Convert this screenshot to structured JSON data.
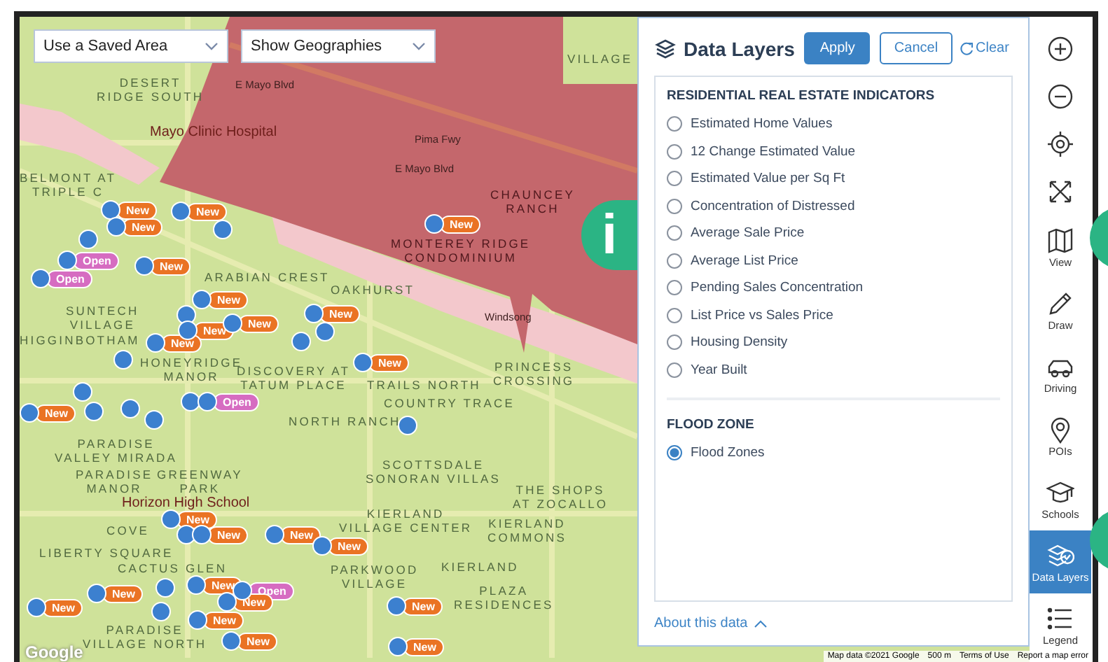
{
  "map": {
    "dropdowns": [
      {
        "value": "Use a Saved Area"
      },
      {
        "value": "Show Geographies"
      }
    ],
    "labels": [
      {
        "kind": "area",
        "lines": [
          "DESERT",
          "RIDGE SOUTH"
        ]
      },
      {
        "kind": "poi",
        "lines": [
          "Mayo Clinic Hospital"
        ]
      },
      {
        "kind": "area",
        "lines": [
          "BELMONT AT",
          "TRIPLE C"
        ]
      },
      {
        "kind": "zone",
        "lines": [
          "CHAUNCEY",
          "RANCH"
        ]
      },
      {
        "kind": "zone",
        "lines": [
          "MONTEREY RIDGE",
          "CONDOMINIUM"
        ]
      },
      {
        "kind": "area",
        "lines": [
          "ARABIAN CREST"
        ]
      },
      {
        "kind": "area",
        "lines": [
          "OAKHURST"
        ]
      },
      {
        "kind": "area",
        "lines": [
          "SUNTECH",
          "VILLAGE"
        ]
      },
      {
        "kind": "area",
        "lines": [
          "HIGGINBOTHAM"
        ]
      },
      {
        "kind": "area",
        "lines": [
          "HONEYRIDGE",
          "MANOR"
        ]
      },
      {
        "kind": "area",
        "lines": [
          "DISCOVERY AT",
          "TATUM PLACE"
        ]
      },
      {
        "kind": "area",
        "lines": [
          "TRAILS NORTH"
        ]
      },
      {
        "kind": "area",
        "lines": [
          "PRINCESS",
          "CROSSING"
        ]
      },
      {
        "kind": "area",
        "lines": [
          "COUNTRY TRACE"
        ]
      },
      {
        "kind": "area",
        "lines": [
          "NORTH RANCH"
        ]
      },
      {
        "kind": "area",
        "lines": [
          "PARADISE",
          "VALLEY MIRADA"
        ]
      },
      {
        "kind": "area",
        "lines": [
          "PARADISE",
          "MANOR"
        ]
      },
      {
        "kind": "area",
        "lines": [
          "GREENWAY",
          "PARK"
        ]
      },
      {
        "kind": "area",
        "lines": [
          "SCOTTSDALE",
          "SONORAN VILLAS"
        ]
      },
      {
        "kind": "poi",
        "lines": [
          "Horizon High School"
        ]
      },
      {
        "kind": "area",
        "lines": [
          "THE SHOPS",
          "AT ZOCALLO"
        ]
      },
      {
        "kind": "area",
        "lines": [
          "COVE"
        ]
      },
      {
        "kind": "area",
        "lines": [
          "KIERLAND",
          "VILLAGE CENTER"
        ]
      },
      {
        "kind": "area",
        "lines": [
          "KIERLAND",
          "COMMONS"
        ]
      },
      {
        "kind": "area",
        "lines": [
          "LIBERTY SQUARE"
        ]
      },
      {
        "kind": "area",
        "lines": [
          "CACTUS GLEN"
        ]
      },
      {
        "kind": "area",
        "lines": [
          "PARKWOOD",
          "VILLAGE"
        ]
      },
      {
        "kind": "area",
        "lines": [
          "KIERLAND"
        ]
      },
      {
        "kind": "area",
        "lines": [
          "PLAZA",
          "RESIDENCES"
        ]
      },
      {
        "kind": "area",
        "lines": [
          "PARADISE",
          "VILLAGE NORTH"
        ]
      },
      {
        "kind": "area",
        "lines": [
          "VILLAGE"
        ]
      },
      {
        "kind": "road",
        "lines": [
          "Windsong"
        ]
      },
      {
        "kind": "road",
        "lines": [
          "Pima Fwy"
        ]
      },
      {
        "kind": "road",
        "lines": [
          "E Mayo Blvd"
        ]
      },
      {
        "kind": "road",
        "lines": [
          "E Mayo Blvd"
        ]
      }
    ],
    "markers": [
      {
        "kind": "new",
        "label": "New"
      },
      {
        "kind": "new",
        "label": "New"
      },
      {
        "kind": "new",
        "label": "New"
      },
      {
        "kind": "plain"
      },
      {
        "kind": "open",
        "label": "Open"
      },
      {
        "kind": "plain"
      },
      {
        "kind": "new",
        "label": "New"
      },
      {
        "kind": "open",
        "label": "Open"
      },
      {
        "kind": "new",
        "label": "New"
      },
      {
        "kind": "new",
        "label": "New"
      },
      {
        "kind": "plain"
      },
      {
        "kind": "new",
        "label": "New"
      },
      {
        "kind": "new",
        "label": "New"
      },
      {
        "kind": "new",
        "label": "New"
      },
      {
        "kind": "plain"
      },
      {
        "kind": "plain"
      },
      {
        "kind": "new",
        "label": "New"
      },
      {
        "kind": "plain"
      },
      {
        "kind": "plain"
      },
      {
        "kind": "plain"
      },
      {
        "kind": "plain"
      },
      {
        "kind": "plain"
      },
      {
        "kind": "new",
        "label": "New"
      },
      {
        "kind": "plain"
      },
      {
        "kind": "open",
        "label": "Open"
      },
      {
        "kind": "plain"
      },
      {
        "kind": "new",
        "label": "New"
      },
      {
        "kind": "plain"
      },
      {
        "kind": "new",
        "label": "New"
      },
      {
        "kind": "new",
        "label": "New"
      },
      {
        "kind": "new",
        "label": "New"
      },
      {
        "kind": "new",
        "label": "New"
      },
      {
        "kind": "plain"
      },
      {
        "kind": "new",
        "label": "New"
      },
      {
        "kind": "open",
        "label": "Open"
      },
      {
        "kind": "new",
        "label": "New"
      },
      {
        "kind": "new",
        "label": "New"
      },
      {
        "kind": "plain"
      },
      {
        "kind": "new",
        "label": "New"
      },
      {
        "kind": "new",
        "label": "New"
      },
      {
        "kind": "new",
        "label": "New"
      },
      {
        "kind": "new",
        "label": "New"
      },
      {
        "kind": "new",
        "label": "New"
      }
    ],
    "info_badge": "i",
    "google_logo": "Google",
    "attribution": [
      "Map data ©2021 Google",
      "500 m",
      "Terms of Use",
      "Report a map error"
    ]
  },
  "panel": {
    "title": "Data Layers",
    "apply": "Apply",
    "cancel": "Cancel",
    "clear": "Clear",
    "sections": [
      {
        "heading": "RESIDENTIAL REAL ESTATE INDICATORS",
        "options": [
          {
            "label": "Estimated Home Values",
            "selected": false
          },
          {
            "label": "12 Change Estimated Value",
            "selected": false
          },
          {
            "label": "Estimated Value per Sq Ft",
            "selected": false
          },
          {
            "label": "Concentration of Distressed",
            "selected": false
          },
          {
            "label": "Average Sale Price",
            "selected": false
          },
          {
            "label": "Average List Price",
            "selected": false
          },
          {
            "label": "Pending Sales Concentration",
            "selected": false
          },
          {
            "label": "List Price vs Sales Price",
            "selected": false
          },
          {
            "label": "Housing Density",
            "selected": false
          },
          {
            "label": "Year Built",
            "selected": false
          }
        ]
      },
      {
        "heading": "FLOOD ZONE",
        "options": [
          {
            "label": "Flood Zones",
            "selected": true
          }
        ]
      }
    ],
    "about": "About this data"
  },
  "toolbar": [
    {
      "kind": "zoom-in",
      "selected": false
    },
    {
      "kind": "zoom-out",
      "selected": false
    },
    {
      "kind": "locate",
      "selected": false
    },
    {
      "kind": "expand",
      "selected": false
    },
    {
      "kind": "view",
      "label": "View",
      "selected": false
    },
    {
      "kind": "draw",
      "label": "Draw",
      "selected": false
    },
    {
      "kind": "driving",
      "label": "Driving",
      "selected": false
    },
    {
      "kind": "pois",
      "label": "POIs",
      "selected": false
    },
    {
      "kind": "schools",
      "label": "Schools",
      "selected": false
    },
    {
      "kind": "layers",
      "label": "Data Layers",
      "selected": true
    },
    {
      "kind": "legend",
      "label": "Legend",
      "selected": false
    }
  ]
}
